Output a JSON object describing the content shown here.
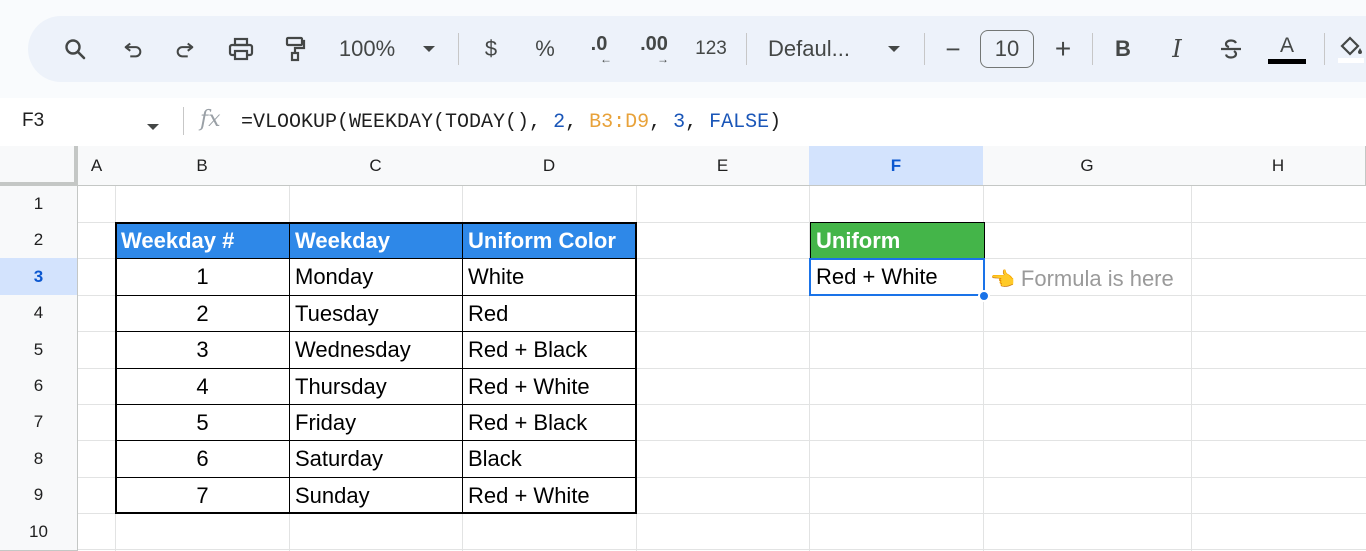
{
  "toolbar": {
    "zoom": "100%",
    "currency": "$",
    "percent": "%",
    "decrease_decimals": ".0",
    "increase_decimals": ".00",
    "number_format": "123",
    "font": "Defaul...",
    "font_size": "10",
    "minus": "−",
    "plus": "+",
    "bold": "B",
    "italic": "I",
    "text_color_letter": "A",
    "icons": [
      "search-icon",
      "undo-icon",
      "redo-icon",
      "print-icon",
      "paint-format-icon",
      "chevron-down-icon",
      "strikethrough-icon",
      "fill-color-icon"
    ]
  },
  "formula_bar": {
    "cell_ref": "F3",
    "fx": "fx",
    "formula_part1": "=VLOOKUP(WEEKDAY(TODAY(), ",
    "formula_arg_days": "2",
    "formula_sep1": ", ",
    "formula_range": "B3:D9",
    "formula_sep2": ", ",
    "formula_col": "3",
    "formula_sep3": ", ",
    "formula_false": "FALSE",
    "formula_close": ")"
  },
  "columns": [
    "A",
    "B",
    "C",
    "D",
    "E",
    "F",
    "G",
    "H"
  ],
  "rows": [
    "1",
    "2",
    "3",
    "4",
    "5",
    "6",
    "7",
    "8",
    "9",
    "10"
  ],
  "table": {
    "headers": [
      "Weekday #",
      "Weekday",
      "Uniform Color"
    ],
    "rows": [
      {
        "num": "1",
        "day": "Monday",
        "color": "White"
      },
      {
        "num": "2",
        "day": "Tuesday",
        "color": "Red"
      },
      {
        "num": "3",
        "day": "Wednesday",
        "color": "Red + Black"
      },
      {
        "num": "4",
        "day": "Thursday",
        "color": "Red + White"
      },
      {
        "num": "5",
        "day": "Friday",
        "color": "Red + Black"
      },
      {
        "num": "6",
        "day": "Saturday",
        "color": "Black"
      },
      {
        "num": "7",
        "day": "Sunday",
        "color": "Red + White"
      }
    ]
  },
  "uniform": {
    "header": "Uniform",
    "value": "Red + White",
    "note": "Formula is here",
    "pointer": "👈"
  },
  "colors": {
    "table_header": "#2e88e8",
    "uniform_header": "#44b549",
    "selection": "#1a73e8"
  }
}
